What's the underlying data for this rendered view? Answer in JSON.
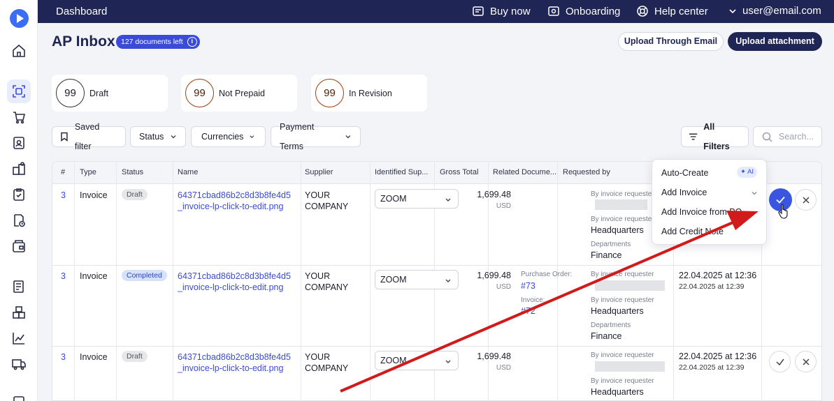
{
  "topbar": {
    "title": "Dashboard",
    "buy_now": "Buy now",
    "onboarding": "Onboarding",
    "help_center": "Help center",
    "user": "user@email.com"
  },
  "header": {
    "title": "AP Inbox",
    "docs_left": "127 documents left",
    "upload_email": "Upload Through Email",
    "upload_attachment": "Upload attachment"
  },
  "cards": [
    {
      "count": "99",
      "label": "Draft"
    },
    {
      "count": "99",
      "label": "Not Prepaid"
    },
    {
      "count": "99",
      "label": "In Revision"
    }
  ],
  "filters": {
    "saved": "Saved filter",
    "status": "Status",
    "currencies": "Currencies",
    "payment_terms": "Payment Terms",
    "all_filters": "All Filters",
    "search_placeholder": "Search..."
  },
  "table": {
    "columns": [
      "#",
      "Type",
      "Status",
      "Name",
      "Supplier",
      "Identified Sup...",
      "Gross Total",
      "Related Docume...",
      "Requested by"
    ],
    "rows": [
      {
        "num": "3",
        "type": "Invoice",
        "status": "Draft",
        "name_1": "64371cbad86b2c8d3b8fe4d5",
        "name_2": "_invoice-lp-click-to-edit.png",
        "supplier_1": "YOUR",
        "supplier_2": "COMPANY",
        "identified": "ZOOM",
        "amount": "1,699.48",
        "currency": "USD",
        "req_label_1": "By invoice requester",
        "req_label_2": "By invoice requester",
        "req_value_2": "Headquarters",
        "req_label_3": "Departments",
        "req_value_3": "Finance"
      },
      {
        "num": "3",
        "type": "Invoice",
        "status": "Completed",
        "name_1": "64371cbad86b2c8d3b8fe4d5",
        "name_2": "_invoice-lp-click-to-edit.png",
        "supplier_1": "YOUR",
        "supplier_2": "COMPANY",
        "identified": "ZOOM",
        "amount": "1,699.48",
        "currency": "USD",
        "related_label_1": "Purchase Order:",
        "related_value_1": "#73",
        "related_label_2": "Invoice:",
        "related_value_2": "#72",
        "req_label_1": "By invoice requester",
        "req_label_2": "By invoice requester",
        "req_value_2": "Headquarters",
        "req_label_3": "Departments",
        "req_value_3": "Finance",
        "date": "22.04.2025 at 12:36",
        "date2": "22.04.2025 at 12:39"
      },
      {
        "num": "3",
        "type": "Invoice",
        "status": "Draft",
        "name_1": "64371cbad86b2c8d3b8fe4d5",
        "name_2": "_invoice-lp-click-to-edit.png",
        "supplier_1": "YOUR",
        "supplier_2": "COMPANY",
        "identified": "ZOOM",
        "amount": "1,699.48",
        "currency": "USD",
        "req_label_1": "By invoice requester",
        "req_label_2": "By invoice requester",
        "req_value_2": "Headquarters",
        "date": "22.04.2025 at 12:36",
        "date2": "22.04.2025 at 12:39"
      }
    ]
  },
  "dropdown": {
    "auto_create": "Auto-Create",
    "ai": "AI",
    "add_invoice": "Add Invoice",
    "add_invoice_po": "Add Invoice from PO",
    "add_credit": "Add Credit Note"
  },
  "colors": {
    "navy": "#1f2554",
    "accent": "#3a4bd8",
    "arrow": "#d11a1a"
  }
}
